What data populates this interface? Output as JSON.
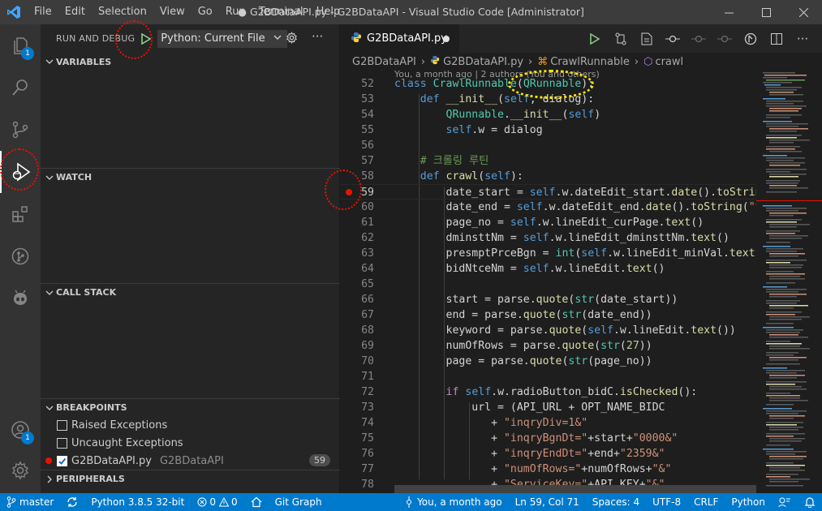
{
  "window": {
    "title": "● G2BDataAPI.py - G2BDataAPI - Visual Studio Code [Administrator]",
    "menu": [
      "File",
      "Edit",
      "Selection",
      "View",
      "Go",
      "Run",
      "Terminal",
      "Help"
    ]
  },
  "activity_bar": {
    "explorer_badge": "1",
    "accounts_badge": "1"
  },
  "sidebar": {
    "title": "RUN AND DEBUG",
    "config": "Python: Current File",
    "sections": {
      "variables": "VARIABLES",
      "watch": "WATCH",
      "call_stack": "CALL STACK",
      "breakpoints": "BREAKPOINTS",
      "peripherals": "PERIPHERALS"
    },
    "breakpoints": [
      {
        "label": "Raised Exceptions",
        "checked": false
      },
      {
        "label": "Uncaught Exceptions",
        "checked": false
      },
      {
        "label": "G2BDataAPI.py",
        "path": "G2BDataAPI",
        "count": "59",
        "checked": true
      }
    ]
  },
  "editor": {
    "tab": "G2BDataAPI.py",
    "breadcrumbs": [
      "G2BDataAPI",
      "G2BDataAPI.py",
      "CrawlRunnable",
      "crawl"
    ],
    "codelens": "You, a month ago | 2 authors (You and others)",
    "line_numbers": [
      "52",
      "53",
      "54",
      "55",
      "56",
      "57",
      "58",
      "59",
      "60",
      "61",
      "62",
      "63",
      "64",
      "65",
      "66",
      "67",
      "68",
      "69",
      "70",
      "71",
      "72",
      "73",
      "74",
      "75",
      "76",
      "77",
      "78"
    ],
    "active_line": "59"
  },
  "statusbar": {
    "branch": "master",
    "python": "Python 3.8.5 32-bit",
    "errors": "0",
    "warnings": "0",
    "git_graph": "Git Graph",
    "blame": "You, a month ago",
    "position": "Ln 59, Col 71",
    "spaces": "Spaces: 4",
    "encoding": "UTF-8",
    "eol": "CRLF",
    "language": "Python"
  }
}
